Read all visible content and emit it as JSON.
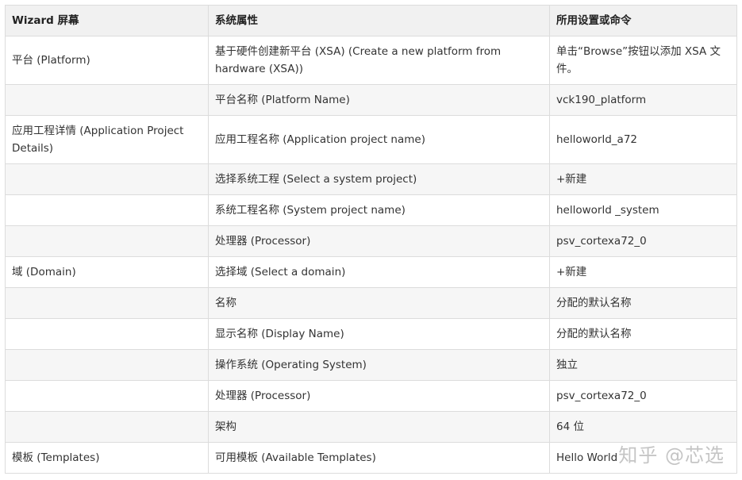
{
  "table": {
    "headers": [
      "Wizard 屏幕",
      "系统属性",
      "所用设置或命令"
    ],
    "rows": [
      [
        "平台 (Platform)",
        "基于硬件创建新平台 (XSA) (Create a new platform from hardware (XSA))",
        "单击“Browse”按钮以添加 XSA 文件。"
      ],
      [
        "",
        "平台名称 (Platform Name)",
        "vck190_platform"
      ],
      [
        "应用工程详情 (Application Project Details)",
        "应用工程名称 (Application project name)",
        "helloworld_a72"
      ],
      [
        "",
        "选择系统工程 (Select a system project)",
        "+新建"
      ],
      [
        "",
        "系统工程名称 (System project name)",
        "helloworld _system"
      ],
      [
        "",
        "处理器 (Processor)",
        "psv_cortexa72_0"
      ],
      [
        "域 (Domain)",
        "选择域 (Select a domain)",
        "+新建"
      ],
      [
        "",
        "名称",
        "分配的默认名称"
      ],
      [
        "",
        "显示名称 (Display Name)",
        "分配的默认名称"
      ],
      [
        "",
        "操作系统 (Operating System)",
        "独立"
      ],
      [
        "",
        "处理器 (Processor)",
        "psv_cortexa72_0"
      ],
      [
        "",
        "架构",
        "64 位"
      ],
      [
        "模板 (Templates)",
        "可用模板 (Available Templates)",
        "Hello World"
      ]
    ]
  },
  "watermark": "知乎 @芯选"
}
